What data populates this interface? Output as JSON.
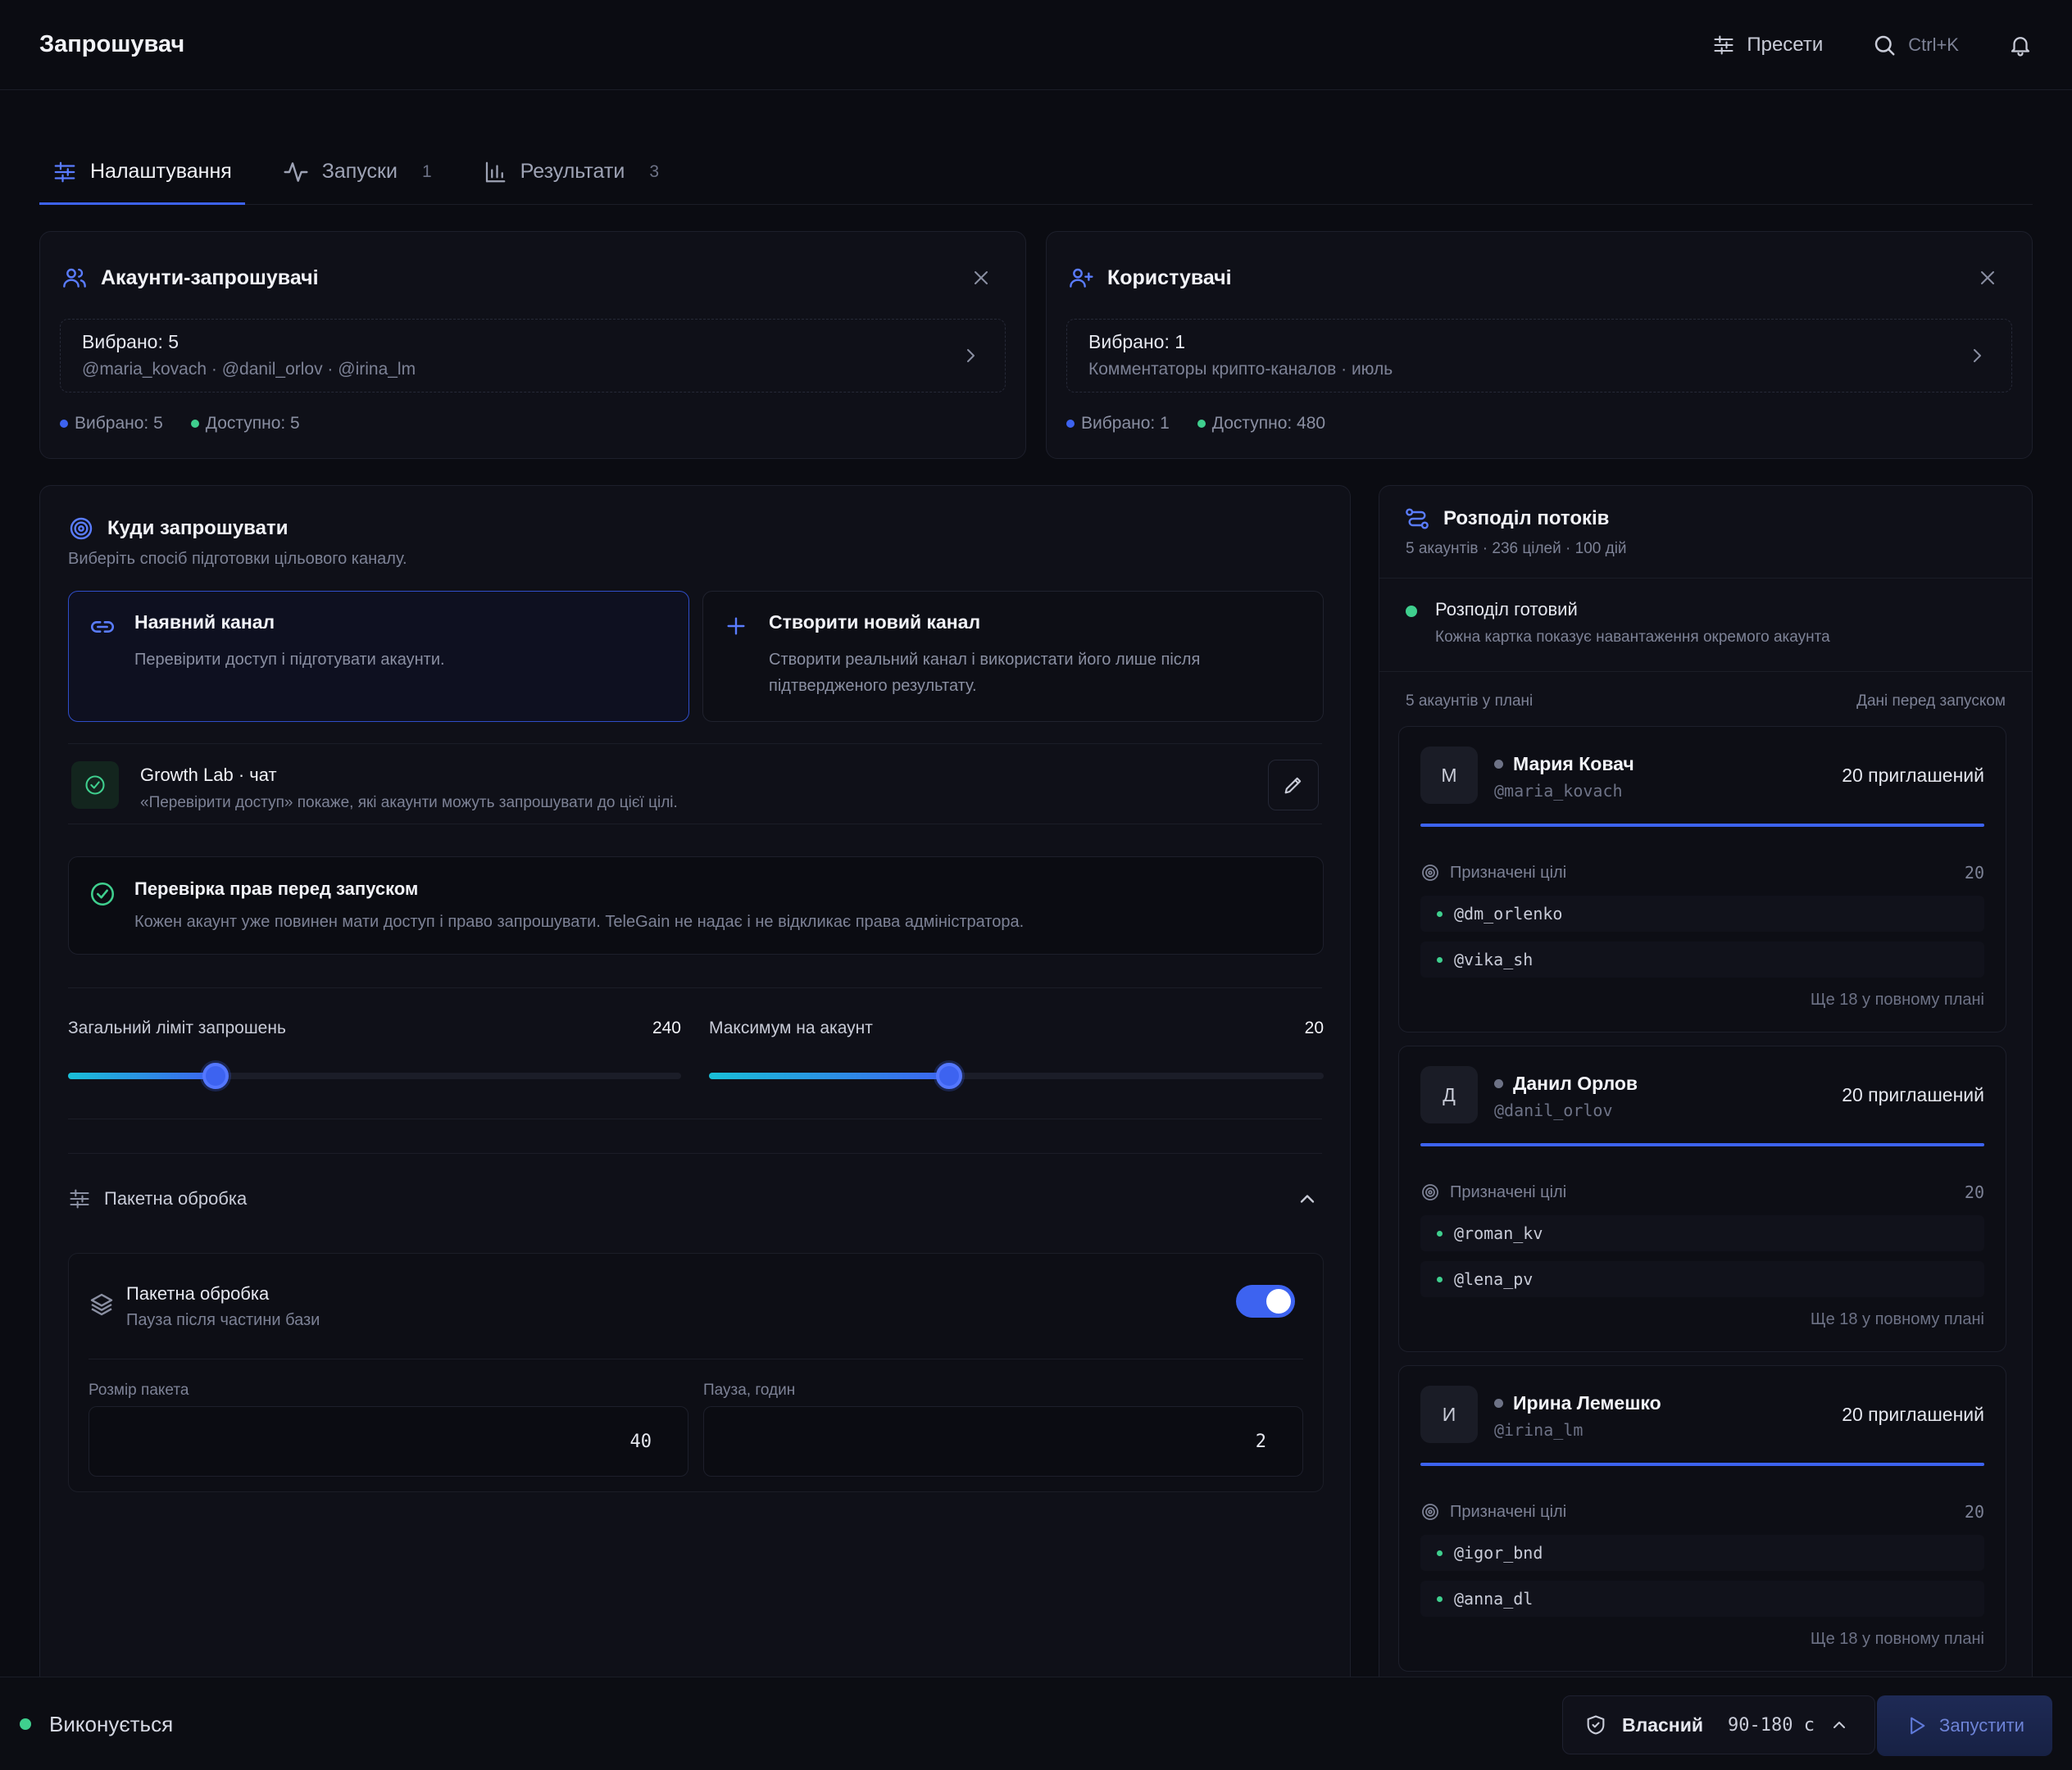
{
  "app": {
    "title": "Запрошувач"
  },
  "top_actions": {
    "presets": "Пресети",
    "search_shortcut": "Ctrl+K"
  },
  "tabs": [
    {
      "label": "Налаштування",
      "count": ""
    },
    {
      "label": "Запуски",
      "count": "1"
    },
    {
      "label": "Результати",
      "count": "3"
    }
  ],
  "inviters": {
    "title": "Акаунти-запрошувачі",
    "selected_line": "Вибрано: 5",
    "handles_line": "@maria_kovach · @danil_orlov · @irina_lm",
    "stat_selected": "Вибрано: 5",
    "stat_available": "Доступно: 5"
  },
  "users": {
    "title": "Користувачі",
    "selected_line": "Вибрано: 1",
    "source_line": "Комментаторы крипто-каналов · июль",
    "stat_selected": "Вибрано: 1",
    "stat_available": "Доступно: 480"
  },
  "target": {
    "title": "Куди запрошувати",
    "subtitle": "Виберіть спосіб підготовки цільового каналу.",
    "options": [
      {
        "title": "Наявний канал",
        "desc": "Перевірити доступ і підготувати акаунти."
      },
      {
        "title": "Створити новий канал",
        "desc": "Створити реальний канал і використати його лише після підтвердженого результату."
      }
    ],
    "chosen_name": "Growth Lab · чат",
    "chosen_hint": "«Перевірити доступ» покаже, які акаунти можуть запрошувати до цієї цілі.",
    "rights_title": "Перевірка прав перед запуском",
    "rights_desc": "Кожен акаунт уже повинен мати доступ і право запрошувати. TeleGain не надає і не відкликає права адміністратора.",
    "limit_total_label": "Загальний ліміт запрошень",
    "limit_total_value": "240",
    "limit_total_fraction": 0.24,
    "limit_per_label": "Максимум на акаунт",
    "limit_per_value": "20",
    "limit_per_fraction": 0.39,
    "batch_section_label": "Пакетна обробка",
    "batch_title": "Пакетна обробка",
    "batch_desc": "Пауза після частини бази",
    "batch_enabled": true,
    "batch_size_label": "Розмір пакета",
    "batch_size_value": "40",
    "pause_label": "Пауза, годин",
    "pause_value": "2"
  },
  "distribution": {
    "title": "Розподіл потоків",
    "subtitle": "5 акаунтів · 236 цілей · 100 дій",
    "status_title": "Розподіл готовий",
    "status_desc": "Кожна картка показує навантаження окремого акаунта",
    "plan_left": "5 акаунтів у плані",
    "plan_right": "Дані перед запуском",
    "accounts": [
      {
        "initial": "М",
        "name": "Мария Ковач",
        "handle": "@maria_kovach",
        "invites": "20 приглашений",
        "targets_label": "Призначені цілі",
        "targets_count": "20",
        "targets": [
          "@dm_orlenko",
          "@vika_sh"
        ],
        "more": "Ще 18 у повному плані"
      },
      {
        "initial": "Д",
        "name": "Данил Орлов",
        "handle": "@danil_orlov",
        "invites": "20 приглашений",
        "targets_label": "Призначені цілі",
        "targets_count": "20",
        "targets": [
          "@roman_kv",
          "@lena_pv"
        ],
        "more": "Ще 18 у повному плані"
      },
      {
        "initial": "И",
        "name": "Ирина Лемешко",
        "handle": "@irina_lm",
        "invites": "20 приглашений",
        "targets_label": "Призначені цілі",
        "targets_count": "20",
        "targets": [
          "@igor_bnd",
          "@anna_dl"
        ],
        "more": "Ще 18 у повному плані"
      }
    ]
  },
  "footer": {
    "status": "Виконується",
    "mode": "Власний",
    "interval": "90-180 с",
    "run_label": "Запустити"
  },
  "colors": {
    "accent": "#3d63f0",
    "success": "#3fcf8e",
    "background": "#0b0c12"
  }
}
